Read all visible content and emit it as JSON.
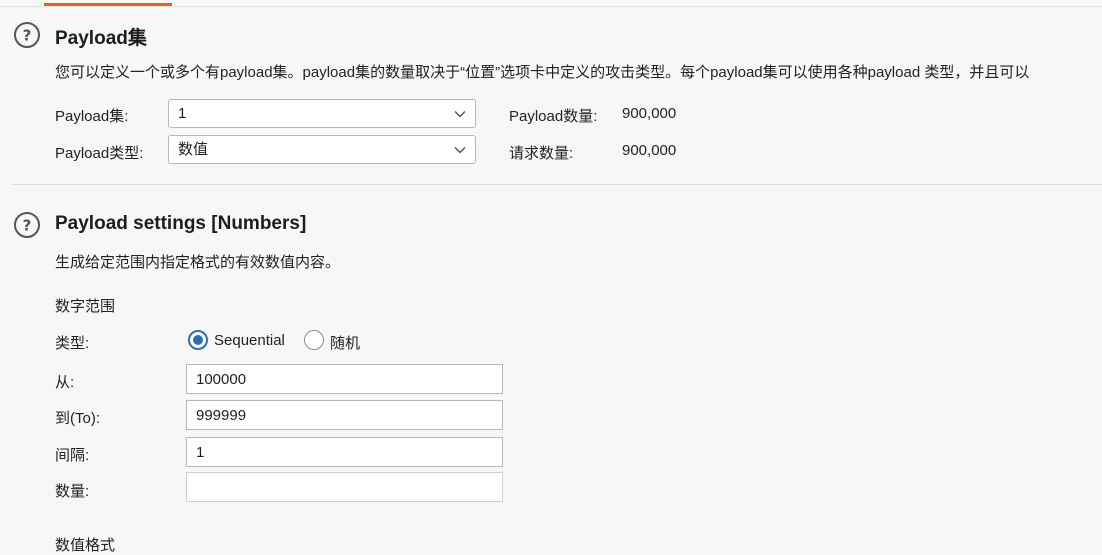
{
  "payload_sets_section": {
    "title": "Payload集",
    "description": "您可以定义一个或多个有payload集。payload集的数量取决于“位置”选项卡中定义的攻击类型。每个payload集可以使用各种payload 类型，并且可以",
    "payload_set_label": "Payload集:",
    "payload_set_value": "1",
    "payload_type_label": "Payload类型:",
    "payload_type_value": "数值",
    "payload_count_label": "Payload数量:",
    "payload_count_value": "900,000",
    "request_count_label": "请求数量:",
    "request_count_value": "900,000"
  },
  "payload_settings_section": {
    "title": "Payload settings [Numbers]",
    "description": "生成给定范围内指定格式的有效数值内容。",
    "number_range_heading": "数字范围",
    "type_label": "类型:",
    "type_options": {
      "sequential": "Sequential",
      "random": "随机"
    },
    "type_selected": "sequential",
    "from_label": "从:",
    "from_value": "100000",
    "to_label": "到(To):",
    "to_value": "999999",
    "step_label": "间隔:",
    "step_value": "1",
    "count_label": "数量:",
    "count_value": "",
    "number_format_heading": "数值格式"
  },
  "colors": {
    "accent_tab": "#e8632b",
    "radio_accent": "#2f6fb0"
  },
  "icons": {
    "help": "help-circle-icon",
    "dropdown": "chevron-down-icon"
  }
}
